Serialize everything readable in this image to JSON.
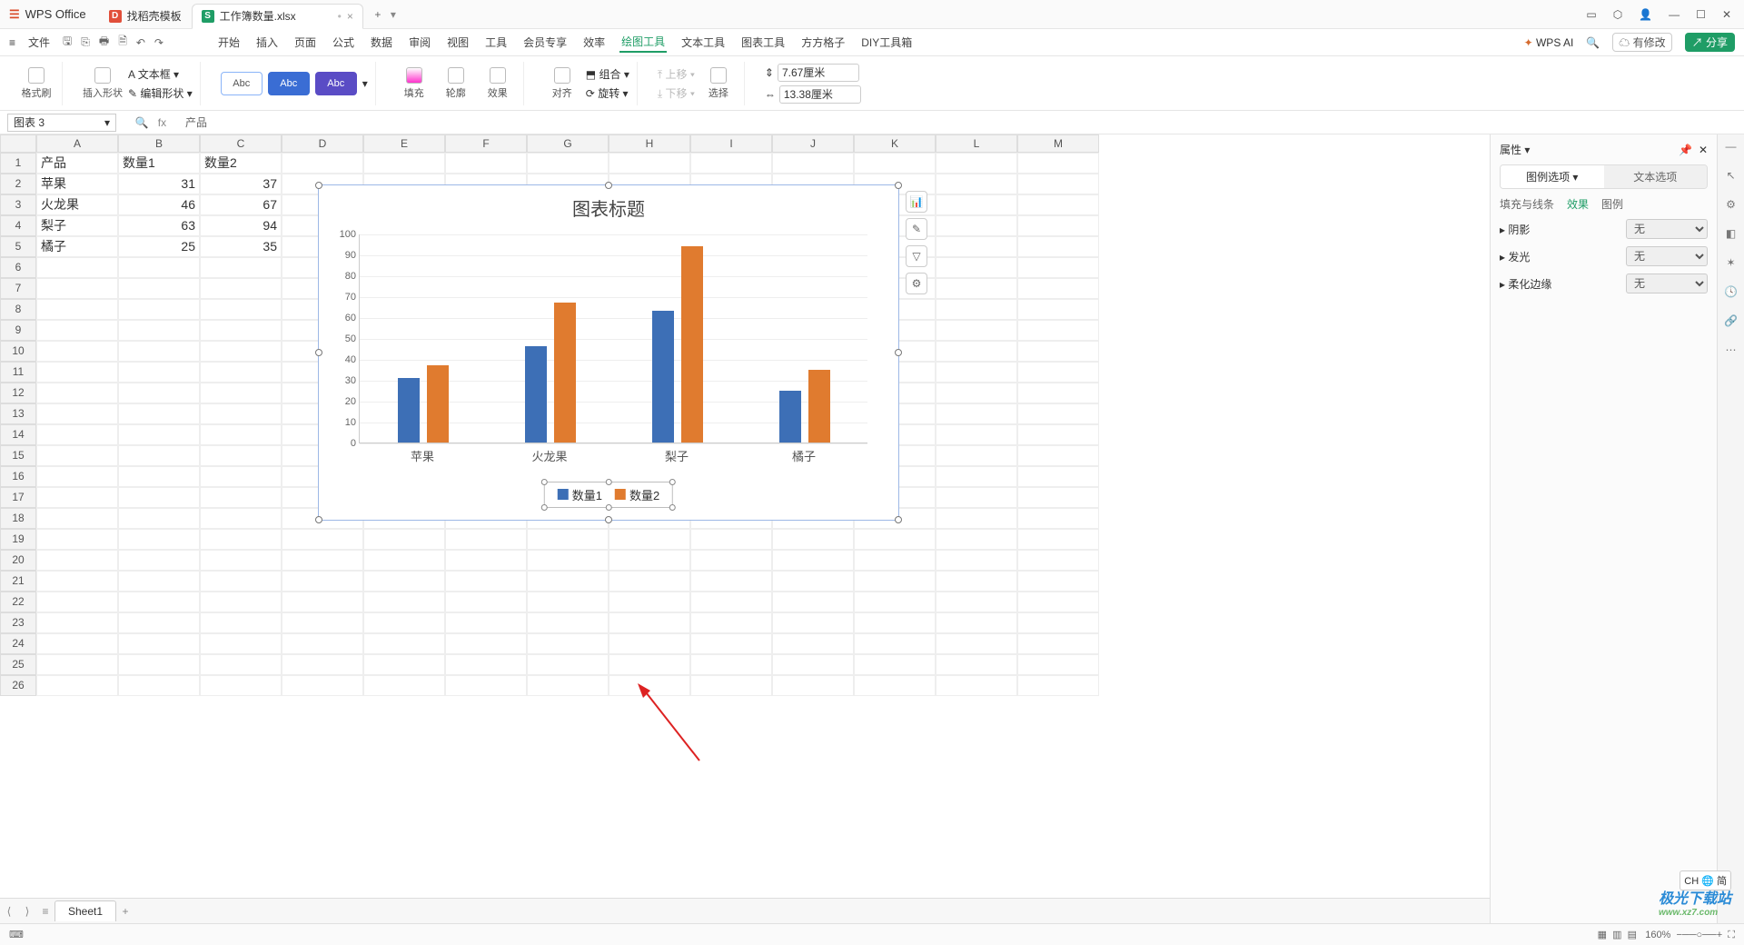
{
  "titlebar": {
    "app": "WPS Office",
    "tab_templates": "找稻壳模板",
    "tab_file": "工作簿数量.xlsx",
    "add": "+"
  },
  "menurow": {
    "file": "文件",
    "tabs": [
      "开始",
      "插入",
      "页面",
      "公式",
      "数据",
      "审阅",
      "视图",
      "工具",
      "会员专享",
      "效率",
      "绘图工具",
      "文本工具",
      "图表工具",
      "方方格子",
      "DIY工具箱"
    ],
    "active_tab": "绘图工具",
    "wpsai": "WPS AI",
    "modifiable": "有修改",
    "share": "分享"
  },
  "ribbon": {
    "format_painter": "格式刷",
    "insert_shape": "插入形状",
    "edit_shape": "编辑形状",
    "textbox": "文本框",
    "style_label": "Abc",
    "fill": "填充",
    "outline": "轮廓",
    "effect": "效果",
    "align": "对齐",
    "group": "组合",
    "rotate": "旋转",
    "up": "上移",
    "down": "下移",
    "select": "选择",
    "w": "7.67厘米",
    "h": "13.38厘米"
  },
  "fbar": {
    "name": "图表 3",
    "fx": "fx",
    "formula": "产品"
  },
  "columns": [
    "A",
    "B",
    "C",
    "D",
    "E",
    "F",
    "G",
    "H",
    "I",
    "J",
    "K",
    "L",
    "M"
  ],
  "table": {
    "headers": [
      "产品",
      "数量1",
      "数量2"
    ],
    "rows": [
      [
        "苹果",
        "31",
        "37"
      ],
      [
        "火龙果",
        "46",
        "67"
      ],
      [
        "梨子",
        "63",
        "94"
      ],
      [
        "橘子",
        "25",
        "35"
      ]
    ]
  },
  "chart_data": {
    "type": "bar",
    "title": "图表标题",
    "categories": [
      "苹果",
      "火龙果",
      "梨子",
      "橘子"
    ],
    "series": [
      {
        "name": "数量1",
        "values": [
          31,
          46,
          63,
          25
        ],
        "color": "#3d6fb6"
      },
      {
        "name": "数量2",
        "values": [
          37,
          67,
          94,
          35
        ],
        "color": "#e07b2f"
      }
    ],
    "ylim": [
      0,
      100
    ],
    "yticks": [
      0,
      10,
      20,
      30,
      40,
      50,
      60,
      70,
      80,
      90,
      100
    ],
    "xlabel": "",
    "ylabel": ""
  },
  "rpanel": {
    "title": "属性",
    "tab_legend": "图例选项",
    "tab_text": "文本选项",
    "sub_fill": "填充与线条",
    "sub_effect": "效果",
    "sub_legend": "图例",
    "shadow": "阴影",
    "glow": "发光",
    "soft": "柔化边缘",
    "none": "无"
  },
  "sheet_tab": "Sheet1",
  "status": {
    "zoom": "160%",
    "ime": "CH 🌐 简"
  },
  "watermark": {
    "name": "极光下载站",
    "url": "www.xz7.com"
  }
}
